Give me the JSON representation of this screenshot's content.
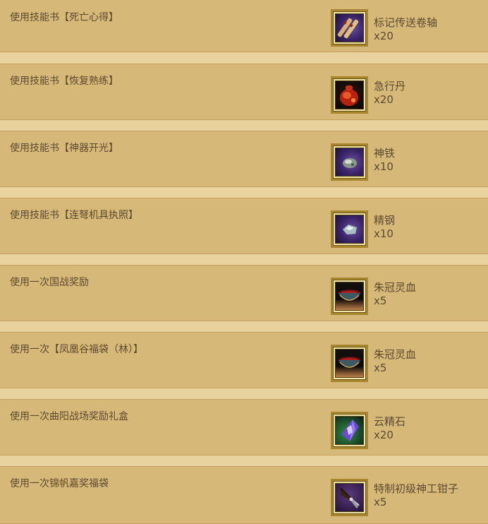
{
  "rewards": [
    {
      "task": "使用技能书【死亡心得】",
      "item": "标记传送卷轴",
      "qty": "x20",
      "icon": "scroll-icon"
    },
    {
      "task": "使用技能书【恢复熟练】",
      "item": "急行丹",
      "qty": "x20",
      "icon": "red-pouch-icon"
    },
    {
      "task": "使用技能书【神器开光】",
      "item": "神铁",
      "qty": "x10",
      "icon": "ore-icon"
    },
    {
      "task": "使用技能书【连弩机具执照】",
      "item": "精钢",
      "qty": "x10",
      "icon": "steel-icon"
    },
    {
      "task": "使用一次国战奖励",
      "item": "朱冠灵血",
      "qty": "x5",
      "icon": "blood-bowl-icon"
    },
    {
      "task": "使用一次【凤凰谷福袋（林）】",
      "item": "朱冠灵血",
      "qty": "x5",
      "icon": "blood-bowl-icon"
    },
    {
      "task": "使用一次曲阳战场奖励礼盒",
      "item": "云精石",
      "qty": "x20",
      "icon": "crystal-icon"
    },
    {
      "task": "使用一次锦帆嘉奖福袋",
      "item": "特制初级神工钳子",
      "qty": "x5",
      "icon": "pliers-icon"
    }
  ]
}
